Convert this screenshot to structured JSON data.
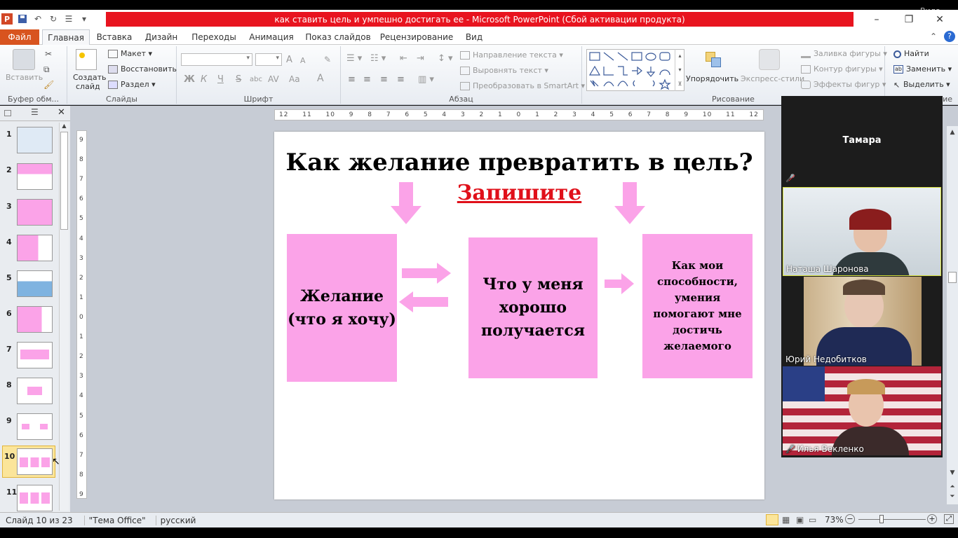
{
  "window": {
    "title": "как ставить цель и умпешно достигать ее  -  Microsoft PowerPoint (Сбой активации продукта)",
    "overlay_label": "Вида"
  },
  "tabs": [
    "Файл",
    "Главная",
    "Вставка",
    "Дизайн",
    "Переходы",
    "Анимация",
    "Показ слайдов",
    "Рецензирование",
    "Вид"
  ],
  "ribbon": {
    "clipboard": {
      "name": "Буфер обм...",
      "paste": "Вставить"
    },
    "slides": {
      "name": "Слайды",
      "create": "Создать",
      "create2": "слайд",
      "layout": "Макет",
      "reset": "Восстановить",
      "section": "Раздел"
    },
    "font": {
      "name": "Шрифт",
      "bold": "Ж",
      "italic": "К",
      "underline": "Ч",
      "strike": "S",
      "shadow": "abc",
      "spacing": "AV",
      "case": "Aa",
      "color": "A",
      "grow": "A",
      "shrink": "A"
    },
    "paragraph": {
      "name": "Абзац",
      "direction": "Направление текста",
      "align": "Выровнять текст",
      "smartart": "Преобразовать в SmartArt"
    },
    "drawing": {
      "name": "Рисование",
      "arrange": "Упорядочить",
      "styles": "Экспресс-стили",
      "fill": "Заливка фигуры",
      "outline": "Контур фигуры",
      "effects": "Эффекты фигур"
    },
    "editing": {
      "find": "Найти",
      "replace": "Заменить",
      "select": "Выделить",
      "partial": "ие"
    }
  },
  "thumbnails": [
    "1",
    "2",
    "3",
    "4",
    "5",
    "6",
    "7",
    "8",
    "9",
    "10",
    "11"
  ],
  "ruler": {
    "h": [
      "12",
      "11",
      "10",
      "9",
      "8",
      "7",
      "6",
      "5",
      "4",
      "3",
      "2",
      "1",
      "0",
      "1",
      "2",
      "3",
      "4",
      "5",
      "6",
      "7",
      "8",
      "9",
      "10",
      "11",
      "12"
    ],
    "v": [
      "9",
      "8",
      "7",
      "6",
      "5",
      "4",
      "3",
      "2",
      "1",
      "0",
      "1",
      "2",
      "3",
      "4",
      "5",
      "6",
      "7",
      "8",
      "9"
    ]
  },
  "slide": {
    "title": "Как желание превратить в цель?",
    "subtitle": "Запишите",
    "box1": "Желание (что я хочу)",
    "box2": "Что у меня хорошо получается",
    "box3": "Как мои способности, умения помогают мне достичь желаемого"
  },
  "status": {
    "slide": "Слайд 10 из 23",
    "theme": "\"Тема Office\"",
    "lang": "русский",
    "zoom": "73%"
  },
  "participants": [
    {
      "name": "Тамара",
      "muted": true,
      "video": false
    },
    {
      "name": "Наташа Шаронова",
      "muted": false,
      "video": true,
      "active": true
    },
    {
      "name": "Юрий Недобитков",
      "muted": false,
      "video": true
    },
    {
      "name": "Илья Векленко",
      "muted": true,
      "video": true
    }
  ],
  "colors": {
    "accent": "#d8541f",
    "title_bar": "#e8141f",
    "pink_box": "#fba3e8",
    "subtitle": "#e0101a"
  }
}
